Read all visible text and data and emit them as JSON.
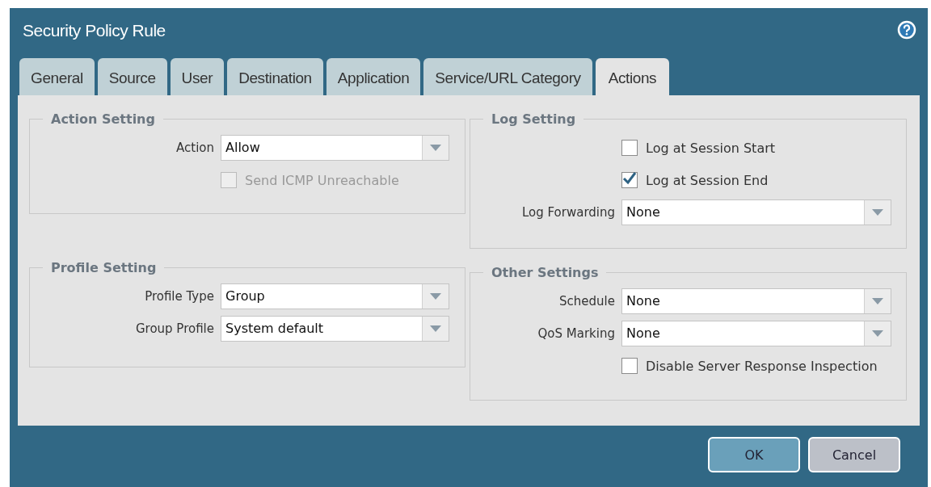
{
  "window": {
    "title": "Security Policy Rule"
  },
  "tabs": [
    {
      "label": "General",
      "selected": false
    },
    {
      "label": "Source",
      "selected": false
    },
    {
      "label": "User",
      "selected": false
    },
    {
      "label": "Destination",
      "selected": false
    },
    {
      "label": "Application",
      "selected": false
    },
    {
      "label": "Service/URL Category",
      "selected": false
    },
    {
      "label": "Actions",
      "selected": true
    }
  ],
  "columns": [
    {
      "sections": [
        {
          "title": "Action Setting",
          "rows": [
            {
              "kind": "select",
              "label": "Action",
              "value": "Allow"
            },
            {
              "kind": "checkbox",
              "label": "Send ICMP Unreachable",
              "checked": false,
              "disabled": true
            }
          ]
        },
        {
          "title": "Profile Setting",
          "rows": [
            {
              "kind": "select",
              "label": "Profile Type",
              "value": "Group"
            },
            {
              "kind": "select",
              "label": "Group Profile",
              "value": "System default"
            }
          ]
        }
      ]
    },
    {
      "sections": [
        {
          "title": "Log Setting",
          "rows": [
            {
              "kind": "checkbox",
              "label": "Log at Session Start",
              "checked": false,
              "disabled": false
            },
            {
              "kind": "checkbox",
              "label": "Log at Session End",
              "checked": true,
              "disabled": false
            },
            {
              "kind": "select",
              "label": "Log Forwarding",
              "value": "None"
            }
          ]
        },
        {
          "title": "Other Settings",
          "rows": [
            {
              "kind": "select",
              "label": "Schedule",
              "value": "None"
            },
            {
              "kind": "select",
              "label": "QoS Marking",
              "value": "None"
            },
            {
              "kind": "checkbox",
              "label": "Disable Server Response Inspection",
              "checked": false,
              "disabled": false
            }
          ]
        }
      ]
    }
  ],
  "buttons": [
    {
      "label": "OK",
      "kind": "primary"
    },
    {
      "label": "Cancel",
      "kind": "secondary"
    }
  ]
}
